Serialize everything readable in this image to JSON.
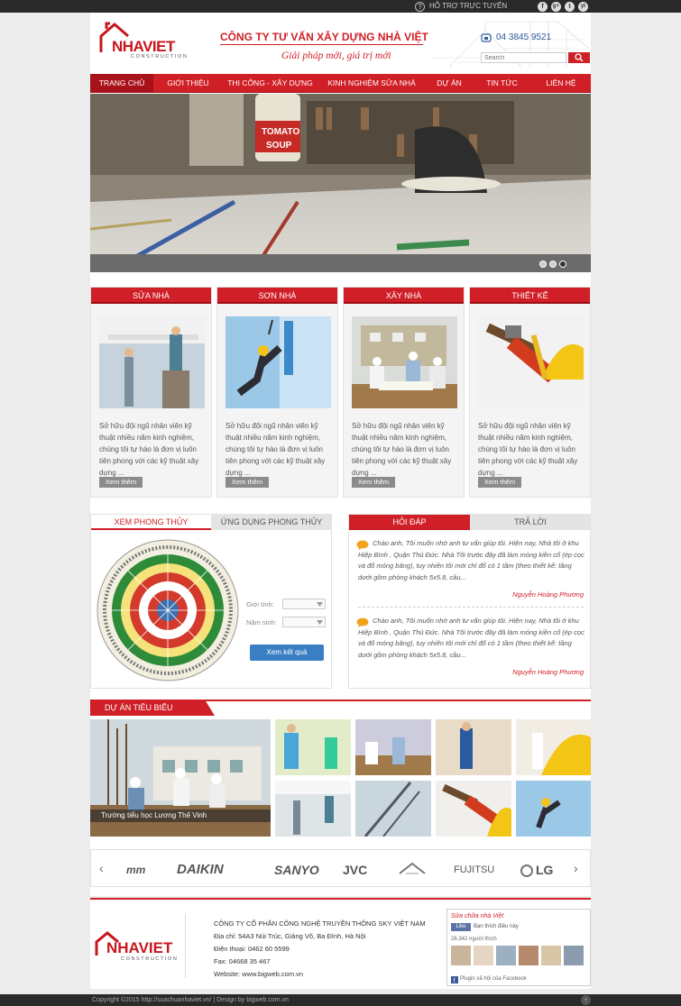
{
  "topbar": {
    "support_label": "HỖ TRỢ TRỰC TUYẾN",
    "social": [
      "f",
      "g+",
      "t",
      "yt"
    ]
  },
  "header": {
    "logo_text": "NHAVIET",
    "logo_sub": "CONSTRUCTION",
    "company": "CÔNG TY TƯ VẤN XÂY DỰNG NHÀ VIỆT",
    "slogan": "Giải pháp mới, giá trị mới",
    "phone": "04 3845 9521",
    "search_placeholder": "Search"
  },
  "nav": [
    "TRANG CHỦ",
    "GIỚI THIỆU",
    "THI CÔNG - XÂY DỰNG",
    "KINH NGHIỆM SỬA NHÀ",
    "DỰ ÁN",
    "TIN TỨC",
    "LIÊN HỆ"
  ],
  "hero": {
    "slide_count": 3,
    "active_slide": 3
  },
  "categories": [
    {
      "title": "SỬA NHÀ",
      "text": "Sở hữu đội ngũ nhân viên kỹ thuật nhiều năm kinh nghiệm, chúng tôi tự hào là đơn vị luôn tiên phong với các kỹ thuật xây dựng ...",
      "button": "Xem thêm"
    },
    {
      "title": "SƠN NHÀ",
      "text": "Sở hữu đội ngũ nhân viên kỹ thuật nhiều năm kinh nghiệm, chúng tôi tự hào là đơn vị luôn tiên phong với các kỹ thuật xây dựng ...",
      "button": "Xem thêm"
    },
    {
      "title": "XÂY NHÀ",
      "text": "Sở hữu đội ngũ nhân viên kỹ thuật nhiều năm kinh nghiệm, chúng tôi tự hào là đơn vị luôn tiên phong với các kỹ thuật xây dựng ...",
      "button": "Xem thêm"
    },
    {
      "title": "THIẾT KẾ",
      "text": "Sở hữu đội ngũ nhân viên kỹ thuật nhiều năm kinh nghiệm, chúng tôi tự hào là đơn vị luôn tiên phong với các kỹ thuật xây dựng ...",
      "button": "Xem thêm"
    }
  ],
  "fengshui": {
    "tab_active": "XEM PHONG THỦY",
    "tab_other": "ỨNG DỤNG PHONG THỦY",
    "gender_label": "Giới tính:",
    "birth_label": "Năm sinh:",
    "submit": "Xem kết quả"
  },
  "faq": {
    "tab_active": "HỎI ĐÁP",
    "tab_other": "TRẢ LỜI",
    "items": [
      {
        "question": "Chào anh, Tôi muốn nhờ anh tư vấn giúp tôi. Hiện nay, Nhà tôi ở khu Hiệp Bình , Quận Thủ Đức. Nhà Tôi trước đây đã làm móng kiền cố (ép cọc và đổ móng băng), tuy nhiên tôi mới chỉ đổ có 1 tầm (theo thiết kế: tầng dưới gồm phòng khách 5x5.8, cầu...",
        "author": "Nguyễn Hoàng Phương"
      },
      {
        "question": "Chào anh, Tôi muốn nhờ anh tư vấn giúp tôi. Hiện nay, Nhà tôi ở khu Hiệp Bình , Quận Thủ Đức. Nhà Tôi trước đây đã làm móng kiền cố (ép cọc và đổ móng băng), tuy nhiên tôi mới chỉ đổ có 1 tầm (theo thiết kế: tầng dưới gồm phòng khách 5x5.8, cầu...",
        "author": "Nguyễn Hoàng Phương"
      }
    ]
  },
  "projects": {
    "title": "DỰ ÁN TIÊU BIỂU",
    "featured_caption": "Trường tiểu học Lương Thế Vinh"
  },
  "brands": [
    "mm",
    "DAIKIN",
    "SANYO",
    "JVC",
    "",
    "FUJITSU",
    "LG"
  ],
  "footer": {
    "company": "CÔNG TY CỔ PHẦN CÔNG NGHỆ TRUYỀN THÔNG SKY VIỆT NAM",
    "address": "Địa chỉ: 54A3 Núi Trúc, Giảng Võ, Ba Đình, Hà Nội",
    "phone": "Điện thoại: 0462 60 5599",
    "fax": "Fax: 04668 35 467",
    "website": "Website: www.bigweb.com.vn",
    "fb_title": "Sửa chữa nhà Việt",
    "fb_like": "Like",
    "fb_liked": "Bạn thích điều này",
    "fb_count": "26.342 người thích",
    "fb_plugin": "Plugin xã hội của Facebook"
  },
  "bottom": {
    "copyright": "Copyright ©2015 http://suachuanhaviet.vn/  |  Design by bigweb.com.vn"
  },
  "colors": {
    "brand_red": "#d01f26",
    "dark_red": "#9c0f14",
    "blue_button": "#3a7fc4"
  }
}
